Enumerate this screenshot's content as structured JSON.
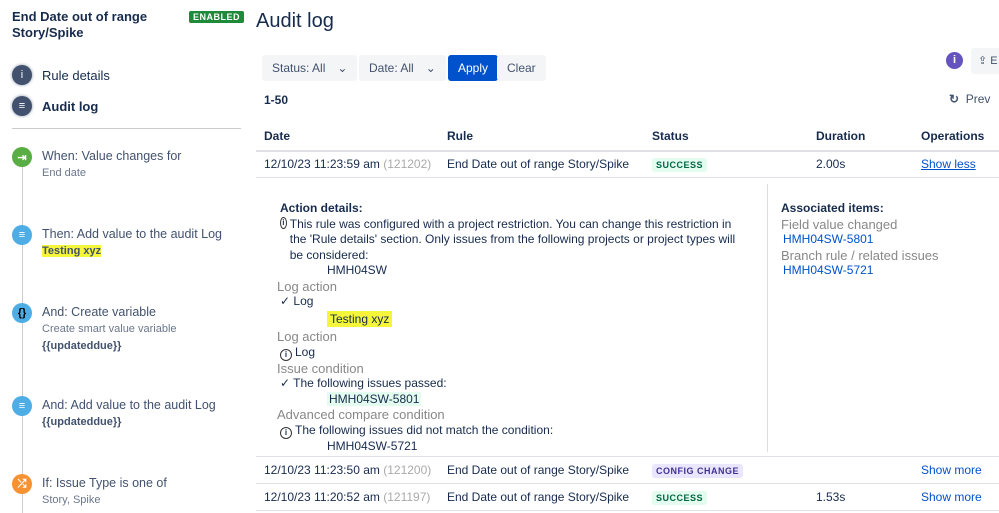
{
  "sidebar": {
    "rule_title": "End Date out of range Story/Spike",
    "badge": "ENABLED",
    "nav": [
      {
        "label": "Rule details",
        "icon": "info-icon"
      },
      {
        "label": "Audit log",
        "icon": "list-icon"
      }
    ],
    "steps": [
      {
        "title": "When: Value changes for",
        "sub": "End date",
        "icon": "trigger-icon",
        "color": "#5aac44"
      },
      {
        "title": "Then: Add value to the audit Log",
        "bold": "Testing xyz",
        "icon": "log-icon",
        "color": "#4fade6"
      },
      {
        "title": "And: Create variable",
        "sub": "Create smart value variable",
        "bold": "{{updateddue}}",
        "icon": "braces-icon",
        "color": "#4fade6"
      },
      {
        "title": "And: Add value to the audit Log",
        "bold": "{{updateddue}}",
        "icon": "log-icon",
        "color": "#4fade6"
      },
      {
        "title": "If: Issue Type is one of",
        "sub": "Story, Spike",
        "icon": "shuffle-icon",
        "color": "#f79232"
      }
    ]
  },
  "main": {
    "title": "Audit log",
    "filters": {
      "status": "Status: All",
      "date": "Date: All",
      "apply": "Apply",
      "clear": "Clear"
    },
    "export_label": "E",
    "range": "1-50",
    "prev": "Prev",
    "columns": [
      "Date",
      "Rule",
      "Status",
      "Duration",
      "Operations"
    ],
    "rows": [
      {
        "date": "12/10/23 11:23:59 am",
        "id": "(121202)",
        "rule": "End Date out of range Story/Spike",
        "status": "SUCCESS",
        "duration": "2.00s",
        "op": "Show less"
      },
      {
        "date": "12/10/23 11:23:50 am",
        "id": "(121200)",
        "rule": "End Date out of range Story/Spike",
        "status": "CONFIG CHANGE",
        "duration": "",
        "op": "Show more"
      },
      {
        "date": "12/10/23 11:20:52 am",
        "id": "(121197)",
        "rule": "End Date out of range Story/Spike",
        "status": "SUCCESS",
        "duration": "1.53s",
        "op": "Show more"
      }
    ],
    "details": {
      "heading": "Action details:",
      "restriction": "This rule was configured with a project restriction. You can change this restriction in the 'Rule details' section. Only issues from the following projects or project types will be considered:",
      "project": "HMH04SW",
      "log1_label": "Log action",
      "log1_text": "Log",
      "log1_value": "Testing xyz",
      "log2_label": "Log action",
      "log2_text": "Log",
      "cond_label": "Issue condition",
      "cond_text": "The following issues passed:",
      "cond_issue": "HMH04SW-5801",
      "adv_label": "Advanced compare condition",
      "adv_text": "The following issues did not match the condition:",
      "adv_issue": "HMH04SW-5721",
      "assoc_heading": "Associated items:",
      "assoc1_label": "Field value changed",
      "assoc1_issue": "HMH04SW-5801",
      "assoc2_label": "Branch rule / related issues",
      "assoc2_issue": "HMH04SW-5721"
    }
  }
}
